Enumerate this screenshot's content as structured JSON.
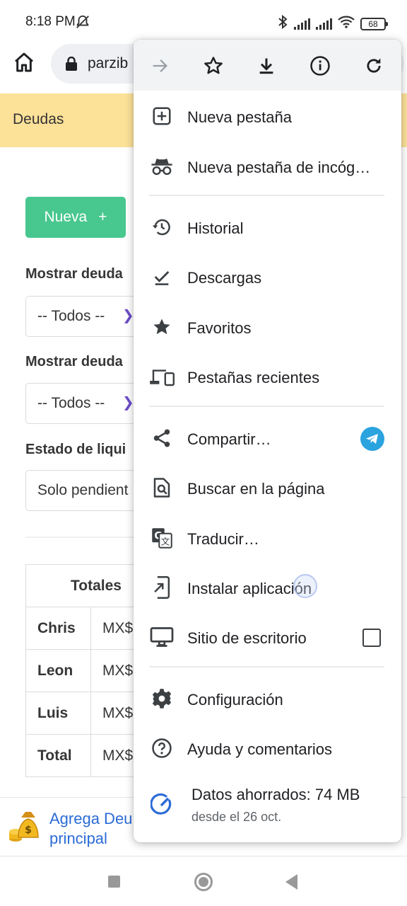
{
  "status_bar": {
    "time": "8:18 PM",
    "battery": "68"
  },
  "browser": {
    "url": "parzib"
  },
  "page": {
    "header_title": "Deudas",
    "new_button": "Nueva",
    "new_button_icon": "+",
    "filter1_label": "Mostrar deuda",
    "filter1_value": "-- Todos --",
    "filter2_label": "Mostrar deuda",
    "filter2_value": "-- Todos --",
    "filter3_label": "Estado de liqui",
    "filter3_value": "Solo pendient",
    "totals_header": "Totales",
    "rows": [
      {
        "name": "Chris",
        "value": "MX$"
      },
      {
        "name": "Leon",
        "value": "MX$"
      },
      {
        "name": "Luis",
        "value": "MX$"
      },
      {
        "name": "Total",
        "value": "MX$"
      }
    ],
    "banner_line1": "Agrega Deu",
    "banner_line2": "principal"
  },
  "menu": {
    "top_icons": [
      "forward-icon",
      "star-outline-icon",
      "download-icon",
      "info-icon",
      "refresh-icon"
    ],
    "items": {
      "new_tab": "Nueva pestaña",
      "incognito": "Nueva pestaña de incóg…",
      "history": "Historial",
      "downloads": "Descargas",
      "bookmarks": "Favoritos",
      "recent_tabs": "Pestañas recientes",
      "share": "Compartir…",
      "find": "Buscar en la página",
      "translate": "Traducir…",
      "install": "Instalar aplicación",
      "desktop": "Sitio de escritorio",
      "settings": "Configuración",
      "help": "Ayuda y comentarios",
      "data_saved": "Datos ahorrados: 74 MB",
      "data_saved_since": "desde el 26 oct."
    },
    "desktop_site_checked": false
  },
  "colors": {
    "header_bg": "#fce199",
    "new_button_bg": "#48c78e",
    "accent_blue": "#2b6bd6",
    "telegram": "#2aa3df"
  }
}
